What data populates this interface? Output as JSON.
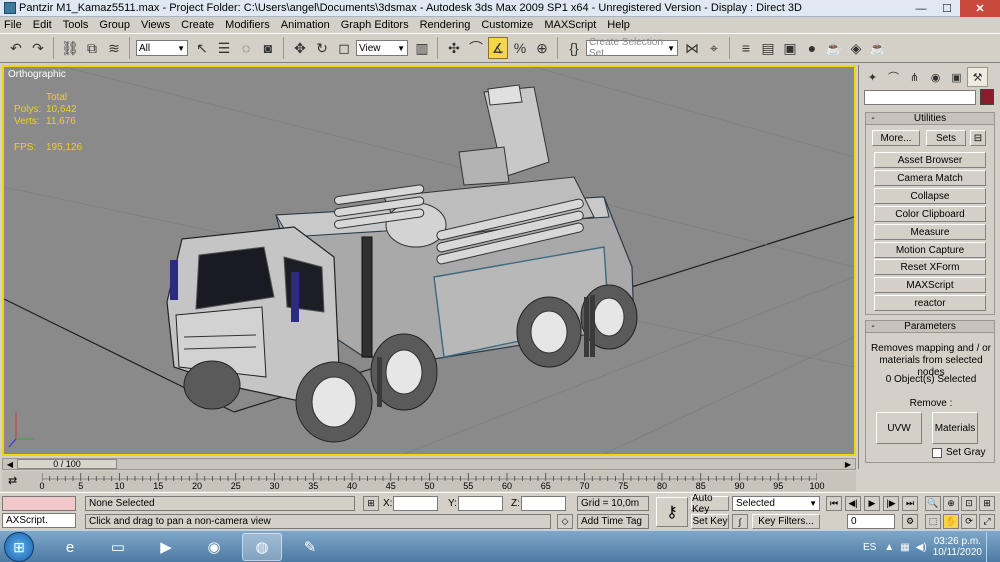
{
  "window": {
    "title": "Pantzir M1_Kamaz5511.max   - Project Folder: C:\\Users\\angel\\Documents\\3dsmax    - Autodesk 3ds Max  2009 SP1  x64  - Unregistered Version    - Display : Direct 3D",
    "minimize": "—",
    "maximize": "☐",
    "close": "✕"
  },
  "menu": [
    "File",
    "Edit",
    "Tools",
    "Group",
    "Views",
    "Create",
    "Modifiers",
    "Animation",
    "Graph Editors",
    "Rendering",
    "Customize",
    "MAXScript",
    "Help"
  ],
  "toolbar": {
    "selection_filter": "All",
    "reference_coord": "View",
    "named_selection_placeholder": "Create Selection Set"
  },
  "viewport": {
    "label": "Orthographic",
    "stats_header": "Total",
    "polys_label": "Polys:",
    "polys_value": "10,642",
    "verts_label": "Verts:",
    "verts_value": "11,676",
    "fps_label": "FPS:",
    "fps_value": "195,126"
  },
  "command_panel": {
    "utilities": {
      "title": "Utilities",
      "more": "More...",
      "sets": "Sets",
      "items": [
        "Asset Browser",
        "Camera Match",
        "Collapse",
        "Color Clipboard",
        "Measure",
        "Motion Capture",
        "Reset XForm",
        "MAXScript",
        "reactor"
      ]
    },
    "parameters": {
      "title": "Parameters",
      "description": "Removes mapping and / or materials from selected nodes",
      "selected": "0 Object(s) Selected",
      "remove_label": "Remove :",
      "uvw": "UVW",
      "materials": "Materials",
      "set_gray": "Set Gray"
    }
  },
  "timeline": {
    "frame": "0 / 100",
    "ticks": [
      "0",
      "5",
      "10",
      "15",
      "20",
      "25",
      "30",
      "35",
      "40",
      "45",
      "50",
      "55",
      "60",
      "65",
      "70",
      "75",
      "80",
      "85",
      "90",
      "95",
      "100"
    ]
  },
  "status": {
    "maxscript_listener": "AXScript.",
    "selection": "None Selected",
    "prompt": "Click and drag to pan a non-camera view",
    "x_label": "X:",
    "y_label": "Y:",
    "z_label": "Z:",
    "grid": "Grid = 10,0m",
    "add_time_tag": "Add Time Tag",
    "auto_key": "Auto Key",
    "set_key": "Set Key",
    "key_mode": "Selected",
    "key_filters": "Key Filters...",
    "current_frame": "0"
  },
  "taskbar": {
    "lang": "ES",
    "time": "03:26 p.m.",
    "date": "10/11/2020"
  }
}
